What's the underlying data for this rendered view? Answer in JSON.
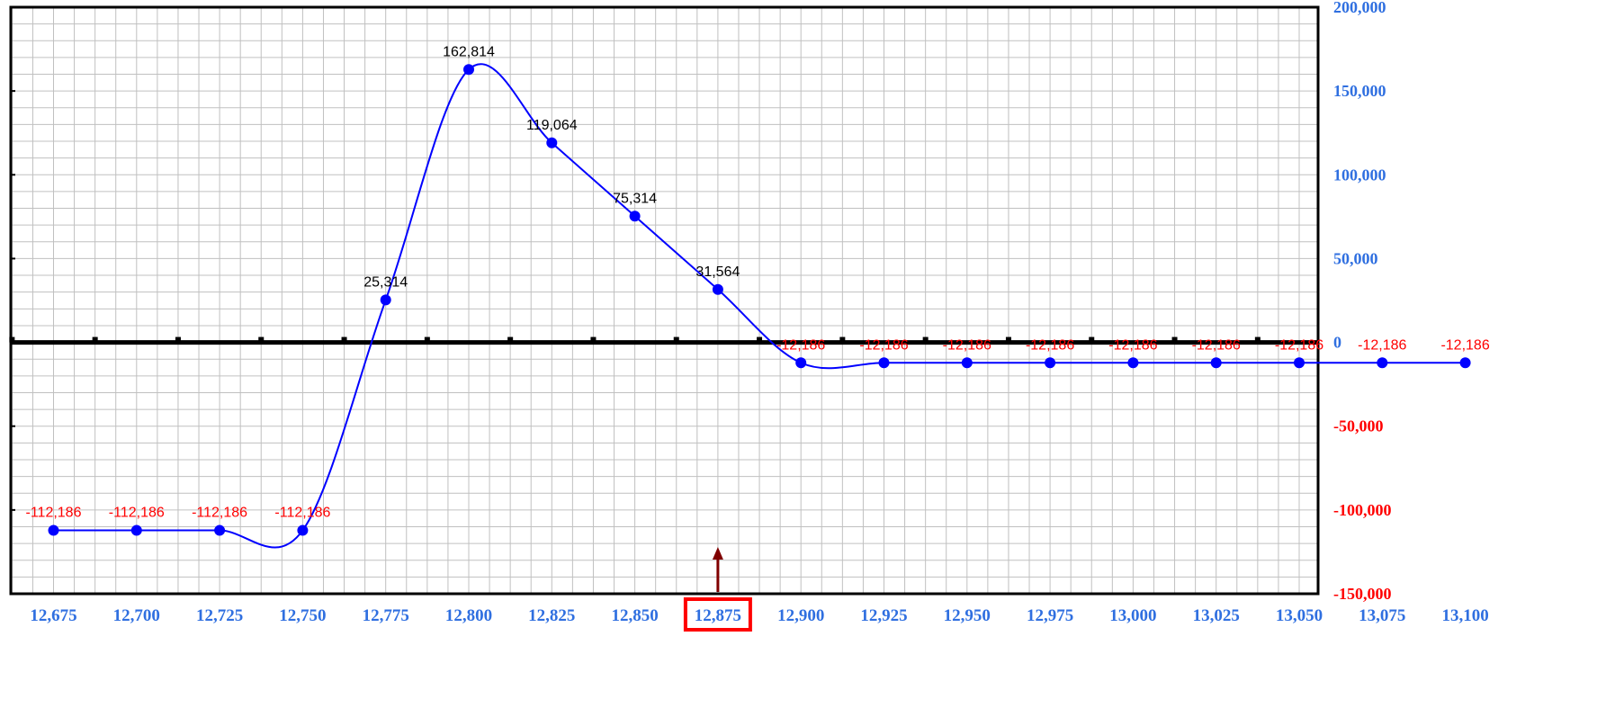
{
  "colors": {
    "line": "#0000ff",
    "positive_label": "#000000",
    "negative_label": "#ff0000",
    "axis_tick_blue": "#2f6fe0",
    "axis_tick_red": "#ff0000",
    "grid": "#c0c0c0",
    "highlight": "#ff0000",
    "marker_arrow": "#800000"
  },
  "chart_data": {
    "type": "line",
    "title": "",
    "xlabel": "",
    "ylabel": "",
    "x": [
      12675,
      12700,
      12725,
      12750,
      12775,
      12800,
      12825,
      12850,
      12875,
      12900,
      12925,
      12950,
      12975,
      13000,
      13025,
      13050,
      13075,
      13100
    ],
    "x_tick_labels": [
      "12,675",
      "12,700",
      "12,725",
      "12,750",
      "12,775",
      "12,800",
      "12,825",
      "12,850",
      "12,875",
      "12,900",
      "12,925",
      "12,950",
      "12,975",
      "13,000",
      "13,025",
      "13,050",
      "13,075",
      "13,100"
    ],
    "series": [
      {
        "values": [
          -112186,
          -112186,
          -112186,
          -112186,
          25314,
          162814,
          119064,
          75314,
          31564,
          -12186,
          -12186,
          -12186,
          -12186,
          -12186,
          -12186,
          -12186,
          -12186,
          -12186
        ],
        "data_labels": [
          "-112,186",
          "-112,186",
          "-112,186",
          "-112,186",
          "25,314",
          "162,814",
          "119,064",
          "75,314",
          "31,564",
          "-12,186",
          "-12,186",
          "-12,186",
          "-12,186",
          "-12,186",
          "-12,186",
          "-12,186",
          "-12,186",
          "-12,186"
        ]
      }
    ],
    "ylim": [
      -150000,
      200000
    ],
    "y_ticks": [
      200000,
      150000,
      100000,
      50000,
      0,
      -50000,
      -100000,
      -150000
    ],
    "y_tick_labels": [
      "200,000",
      "150,000",
      "100,000",
      "50,000",
      "0",
      "-50,000",
      "-100,000",
      "-150,000"
    ],
    "y_axis_side": "right",
    "grid": true,
    "smooth": true,
    "highlighted_x": 12875,
    "highlighted_x_label": "12,875"
  }
}
